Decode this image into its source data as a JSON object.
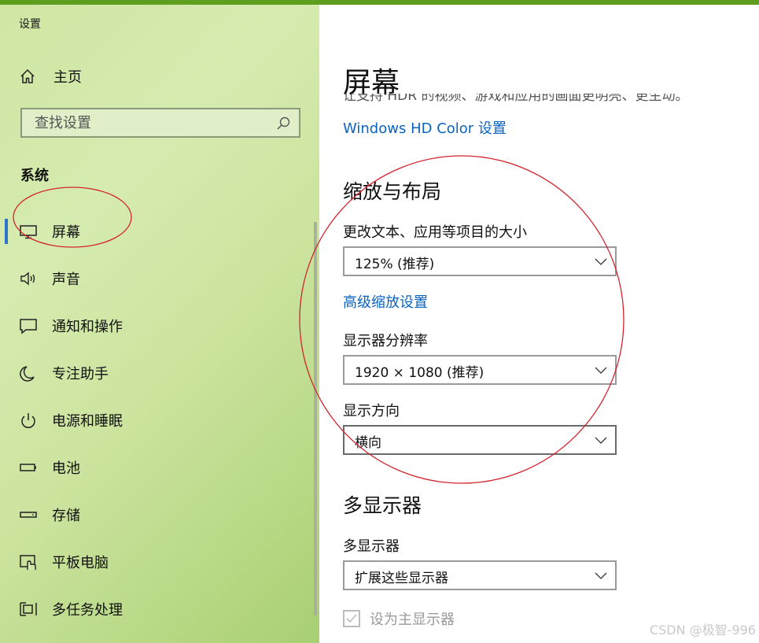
{
  "app": {
    "title": "设置"
  },
  "sidebar": {
    "home_label": "主页",
    "search": {
      "placeholder": "查找设置"
    },
    "section_title": "系统",
    "items": [
      {
        "label": "屏幕",
        "icon": "monitor-icon",
        "selected": true
      },
      {
        "label": "声音",
        "icon": "speaker-icon"
      },
      {
        "label": "通知和操作",
        "icon": "notification-icon"
      },
      {
        "label": "专注助手",
        "icon": "moon-icon"
      },
      {
        "label": "电源和睡眠",
        "icon": "power-icon"
      },
      {
        "label": "电池",
        "icon": "battery-icon"
      },
      {
        "label": "存储",
        "icon": "storage-icon"
      },
      {
        "label": "平板电脑",
        "icon": "tablet-icon"
      },
      {
        "label": "多任务处理",
        "icon": "multitask-icon"
      }
    ]
  },
  "main": {
    "title": "屏幕",
    "clipped_desc": "让支持 HDR 的视频、游戏和应用的画面更明亮、更生动。",
    "hd_link": "Windows HD Color 设置",
    "scale_section": {
      "title": "缩放与布局",
      "text_size_label": "更改文本、应用等项目的大小",
      "text_size_value": "125% (推荐)",
      "advanced_link": "高级缩放设置",
      "resolution_label": "显示器分辨率",
      "resolution_value": "1920 × 1080 (推荐)",
      "orientation_label": "显示方向",
      "orientation_value": "横向"
    },
    "multi_section": {
      "title": "多显示器",
      "label": "多显示器",
      "value": "扩展这些显示器",
      "primary_checkbox": "设为主显示器"
    }
  },
  "watermark": "CSDN @极智-996",
  "colors": {
    "accent": "#2b74c9",
    "link": "#0a63c2",
    "annotation": "#d4232e"
  }
}
